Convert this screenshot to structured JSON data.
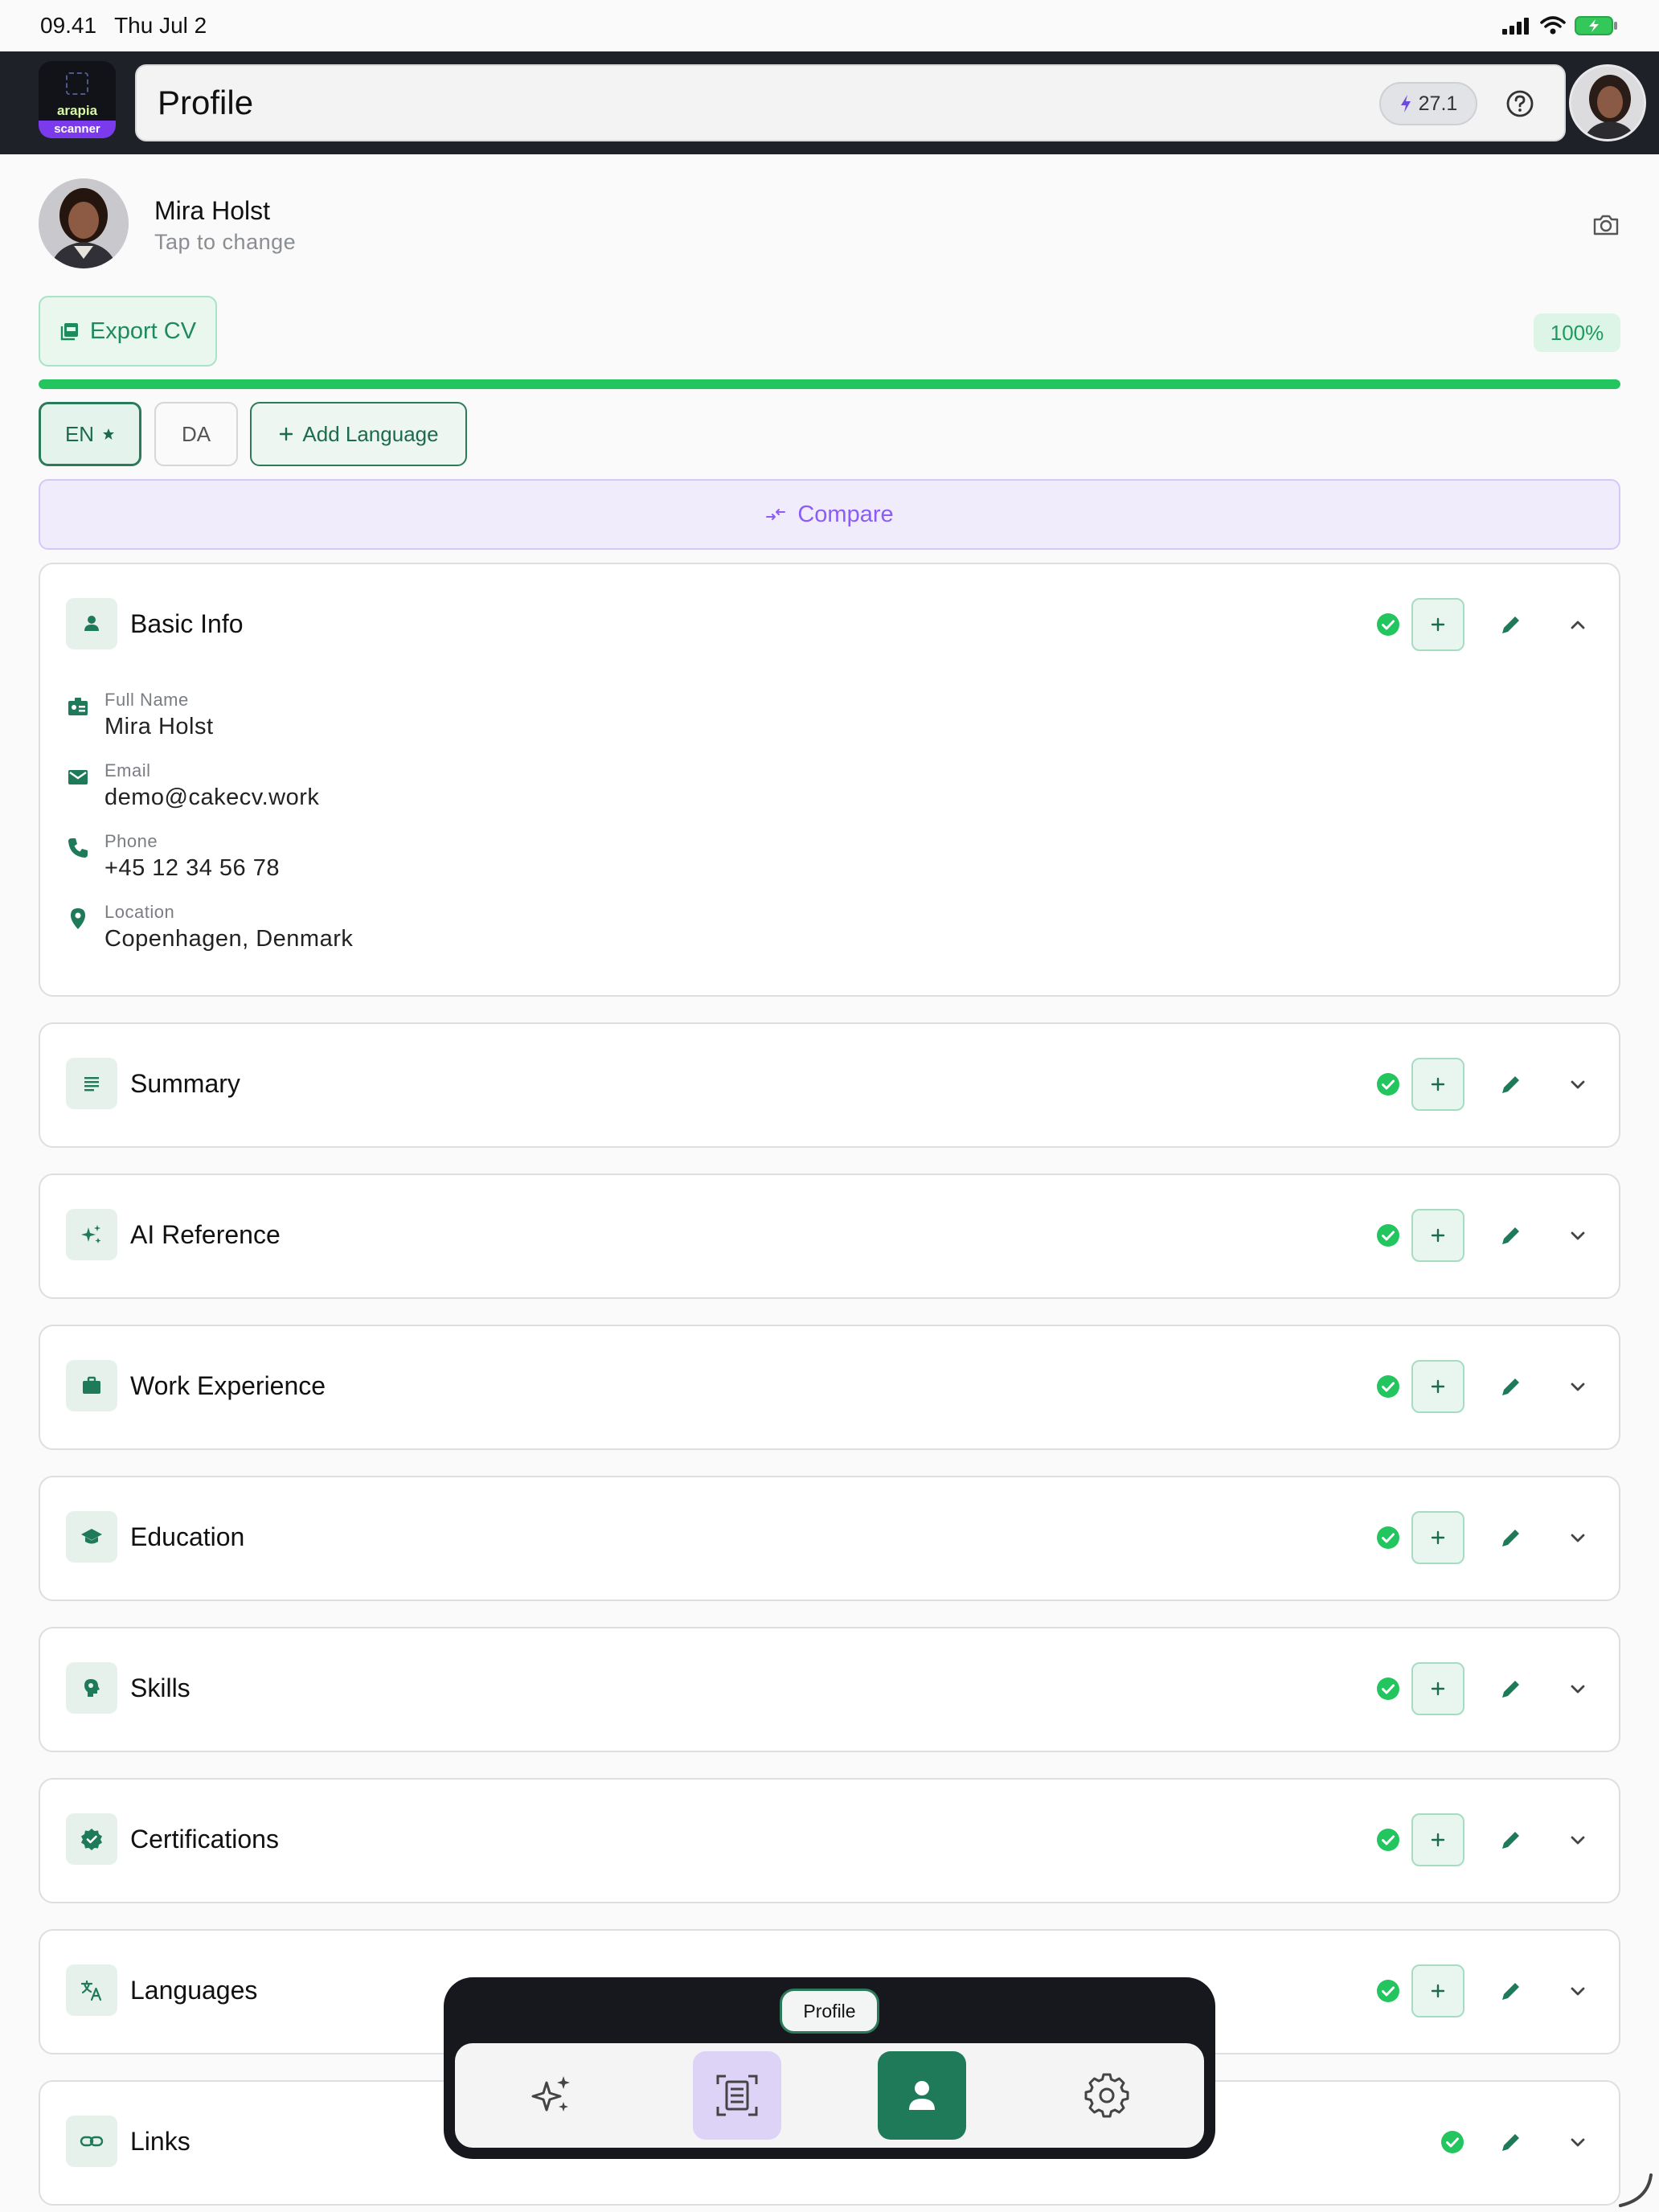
{
  "status_bar": {
    "time": "09.41",
    "date": "Thu Jul 2"
  },
  "header": {
    "logo": {
      "brand": "arapia",
      "badge": "scanner"
    },
    "title": "Profile",
    "energy": "27.1",
    "icons": [
      "bolt-icon",
      "help-circle-icon"
    ]
  },
  "profile": {
    "name": "Mira Holst",
    "hint": "Tap to change"
  },
  "actions": {
    "export_label": "Export CV",
    "completion": "100%",
    "completion_value": 1.0
  },
  "languages": {
    "primary": "EN",
    "secondary": "DA",
    "add_label": "Add Language"
  },
  "compare": {
    "label": "Compare"
  },
  "sections": {
    "basic_info": {
      "title": "Basic Info",
      "fields": [
        {
          "label": "Full Name",
          "value": "Mira Holst",
          "icon": "badge-icon"
        },
        {
          "label": "Email",
          "value": "demo@cakecv.work",
          "icon": "mail-icon"
        },
        {
          "label": "Phone",
          "value": "+45 12 34 56 78",
          "icon": "phone-icon"
        },
        {
          "label": "Location",
          "value": "Copenhagen, Denmark",
          "icon": "location-pin-icon"
        }
      ]
    },
    "summary": {
      "title": "Summary",
      "icon": "text-lines-icon"
    },
    "ai_reference": {
      "title": "AI Reference",
      "icon": "sparkles-icon"
    },
    "work_experience": {
      "title": "Work Experience",
      "icon": "briefcase-icon"
    },
    "education": {
      "title": "Education",
      "icon": "graduation-cap-icon"
    },
    "skills": {
      "title": "Skills",
      "icon": "brain-icon"
    },
    "certifications": {
      "title": "Certifications",
      "icon": "verified-badge-icon"
    },
    "languages": {
      "title": "Languages",
      "icon": "translate-icon"
    },
    "links": {
      "title": "Links",
      "icon": "link-icon"
    }
  },
  "bottom_nav": {
    "tooltip": "Profile",
    "items": [
      "sparkles-icon",
      "document-scan-icon",
      "person-icon",
      "gear-icon"
    ],
    "active": "person-icon"
  },
  "colors": {
    "accent": "#1e7a59",
    "success": "#22c55e",
    "purple": "#8b5cf6",
    "header_bg": "#1f2129"
  }
}
